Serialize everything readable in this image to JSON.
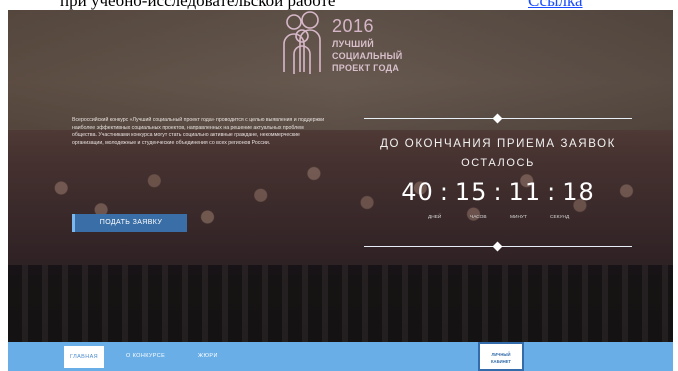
{
  "topline": {
    "text": "при учебно-исследовательской работе",
    "link": "Ссылка"
  },
  "logo": {
    "year": "2016",
    "lines": [
      "ЛУЧШИЙ",
      "СОЦИАЛЬНЫЙ",
      "ПРОЕКТ ГОДА"
    ]
  },
  "hero": {
    "description": "Всероссийский конкурс «Лучший социальный проект года» проводится с целью выявления и поддержки наиболее эффективных социальных проектов, направленных на решение актуальных проблем общества. Участниками конкурса могут стать социально активные граждане, некоммерческие организации, молодежные и студенческие объединения со всех регионов России.",
    "apply_button": "ПОДАТЬ ЗАЯВКУ"
  },
  "countdown": {
    "title": "ДО ОКОНЧАНИЯ ПРИЕМА ЗАЯВОК",
    "subtitle": "ОСТАЛОСЬ",
    "days": "40",
    "hours": "15",
    "minutes": "11",
    "seconds": "18",
    "labels": [
      "ДНЕЙ",
      "ЧАСОВ",
      "МИНУТ",
      "СЕКУНД"
    ]
  },
  "nav": {
    "items": [
      "ГЛАВНАЯ",
      "О КОНКУРСЕ",
      "ЖЮРИ"
    ],
    "active_index": 0,
    "badge_lines": [
      "ЛИЧНЫЙ",
      "КАБИНЕТ"
    ]
  },
  "colors": {
    "nav_bg": "#69aee7",
    "button_bg": "#3a6ea6",
    "badge_border": "#336bab"
  }
}
